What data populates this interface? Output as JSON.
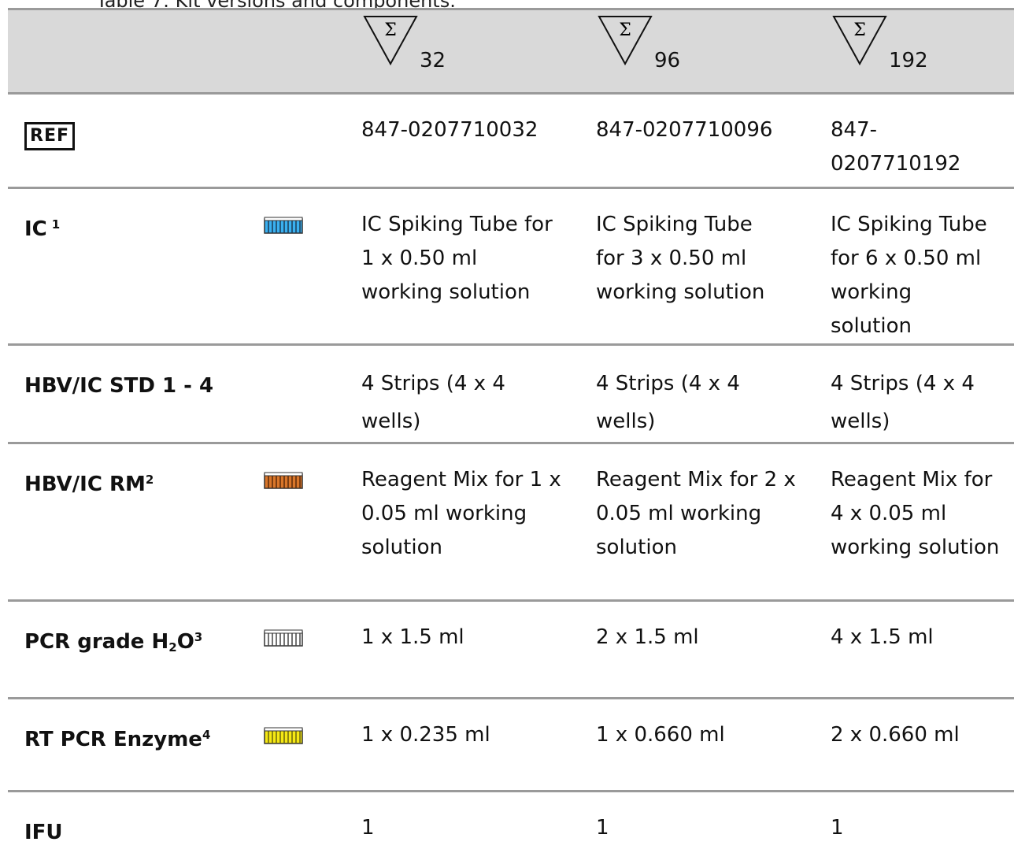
{
  "caption": "Table 7: Kit versions and components.",
  "header": {
    "sizes": [
      "32",
      "96",
      "192"
    ],
    "symbol": "sigma-triangle-icon"
  },
  "ref_symbol": "REF",
  "rows": [
    {
      "label": "IC",
      "sup": "1",
      "tube_color": "#3ab0f0",
      "values": [
        "IC Spiking Tube for 1 x 0.50 ml working solution",
        "IC Spiking Tube for 3 x 0.50 ml working solution",
        "IC Spiking Tube for 6 x 0.50 ml working solution"
      ]
    },
    {
      "label": "HBV/IC STD 1 - 4",
      "values": [
        "4 Strips (4 x 4 wells)",
        "4 Strips (4 x 4 wells)",
        "4 Strips (4 x 4 wells)"
      ]
    },
    {
      "label": "HBV/IC RM",
      "sup": "2",
      "tube_color": "#d9762a",
      "values": [
        "Reagent Mix for 1 x 0.05 ml working solution",
        "Reagent Mix for 2 x 0.05 ml working solution",
        "Reagent Mix for 4 x 0.05 ml working solution"
      ]
    },
    {
      "label": "PCR grade H",
      "sub": "2",
      "label_tail": "O",
      "sup": "3",
      "tube_color": "#ffffff",
      "values": [
        "1 x 1.5 ml",
        "2 x 1.5 ml",
        "4 x 1.5 ml"
      ]
    },
    {
      "label": "RT PCR Enzyme",
      "sup": "4",
      "tube_color": "#f5e814",
      "values": [
        "1 x 0.235 ml",
        "1 x 0.660 ml",
        "2 x 0.660 ml"
      ]
    },
    {
      "label": "IFU",
      "values": [
        "1",
        "1",
        "1"
      ]
    }
  ],
  "ref_values": [
    "847-0207710032",
    "847-0207710096",
    "847-0207710192"
  ]
}
